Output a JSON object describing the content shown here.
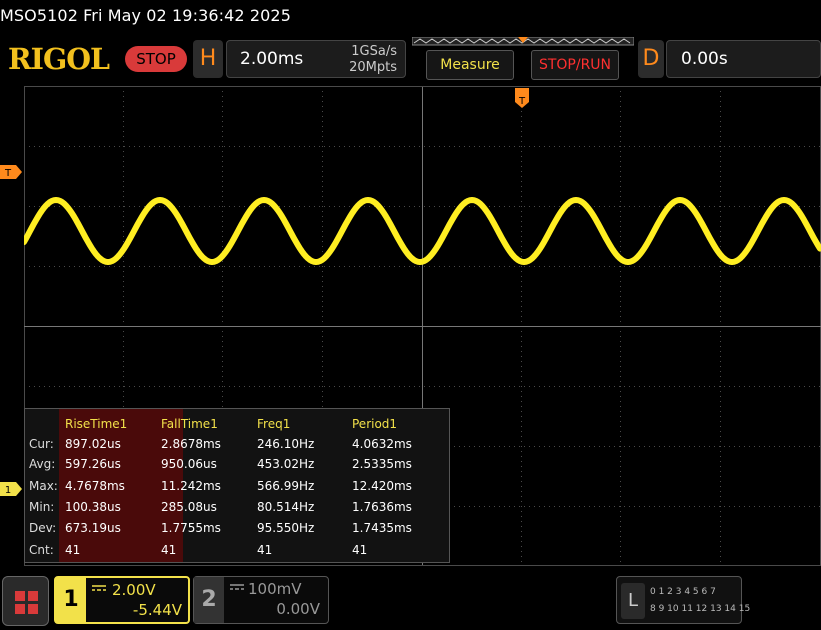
{
  "header": {
    "device_time": "MSO5102  Fri May 02 19:36:42 2025"
  },
  "topbar": {
    "logo": "RIGOL",
    "run_state": "STOP",
    "horizontal": {
      "key": "H",
      "timebase": "2.00ms",
      "sample_rate": "1GSa/s",
      "memory_depth": "20Mpts"
    },
    "measure_label": "Measure",
    "stoprun_label": "STOP/RUN",
    "delay": {
      "key": "D",
      "value": "0.00s"
    }
  },
  "screen": {
    "trigger_level_marker": "T",
    "ch1_marker": "1",
    "trigger_position_marker": "T"
  },
  "measurements": {
    "columns": [
      "RiseTime1",
      "FallTime1",
      "Freq1",
      "Period1"
    ],
    "rows": [
      {
        "label": "Cur:",
        "values": [
          "897.02us",
          "2.8678ms",
          "246.10Hz",
          "4.0632ms"
        ]
      },
      {
        "label": "Avg:",
        "values": [
          "597.26us",
          "950.06us",
          "453.02Hz",
          "2.5335ms"
        ]
      },
      {
        "label": "Max:",
        "values": [
          "4.7678ms",
          "11.242ms",
          "566.99Hz",
          "12.420ms"
        ]
      },
      {
        "label": "Min:",
        "values": [
          "100.38us",
          "285.08us",
          "80.514Hz",
          "1.7636ms"
        ]
      },
      {
        "label": "Dev:",
        "values": [
          "673.19us",
          "1.7755ms",
          "95.550Hz",
          "1.7435ms"
        ]
      },
      {
        "label": "Cnt:",
        "values": [
          "41",
          "41",
          "41",
          "41"
        ]
      }
    ]
  },
  "channels": {
    "ch1": {
      "number": "1",
      "scale": "2.00V",
      "offset": "-5.44V",
      "color": "#f2e14a"
    },
    "ch2": {
      "number": "2",
      "scale": "100mV",
      "offset": "0.00V",
      "color": "#999999"
    }
  },
  "logic": {
    "key": "L",
    "row1": "0 1 2 3   4 5 6 7",
    "row2": "8 9 10 11  12 13 14 15"
  },
  "colors": {
    "trace": "#ffee22",
    "grid": "#5a5a5a",
    "accent": "#ff8a1c",
    "stop": "#d93a3a"
  }
}
